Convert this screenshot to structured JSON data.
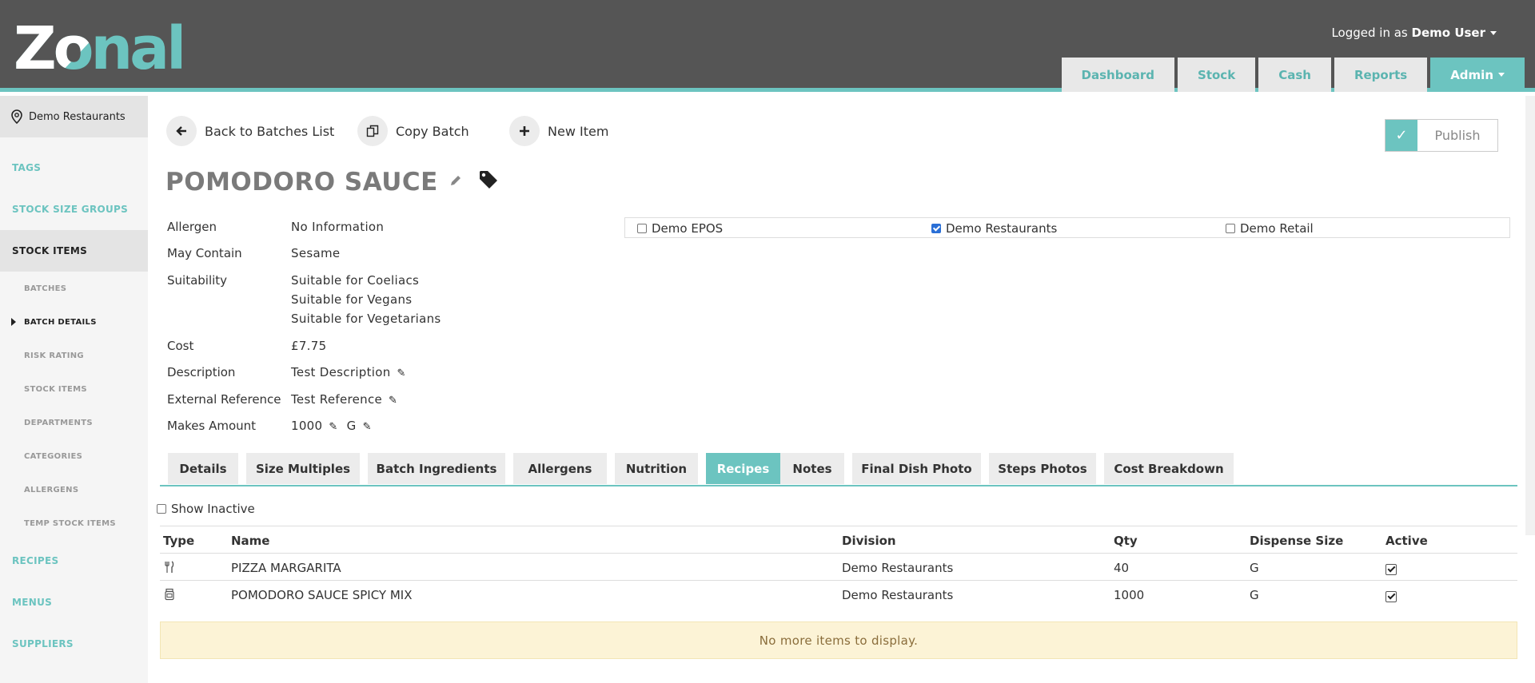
{
  "header": {
    "logo_text": "Zonal",
    "logged_in_prefix": "Logged in as",
    "user_name": "Demo User",
    "nav": [
      "Dashboard",
      "Stock",
      "Cash",
      "Reports",
      "Admin"
    ]
  },
  "sidebar": {
    "site": "Demo Restaurants",
    "items": [
      "TAGS",
      "STOCK SIZE GROUPS",
      "STOCK ITEMS"
    ],
    "sub_items": [
      "BATCHES",
      "BATCH DETAILS",
      "RISK RATING",
      "STOCK ITEMS",
      "DEPARTMENTS",
      "CATEGORIES",
      "ALLERGENS",
      "TEMP STOCK ITEMS"
    ],
    "bottom_items": [
      "RECIPES",
      "MENUS",
      "SUPPLIERS"
    ]
  },
  "actions": {
    "back": "Back to Batches List",
    "copy": "Copy Batch",
    "new": "New Item",
    "publish": "Publish"
  },
  "title": "POMODORO SAUCE",
  "props": {
    "allergen_label": "Allergen",
    "allergen": "No Information",
    "may_contain_label": "May Contain",
    "may_contain": "Sesame",
    "suitability_label": "Suitability",
    "suitability": [
      "Suitable for Coeliacs",
      "Suitable for Vegans",
      "Suitable for Vegetarians"
    ],
    "cost_label": "Cost",
    "cost": "£7.75",
    "description_label": "Description",
    "description": "Test Description",
    "extref_label": "External Reference",
    "extref": "Test Reference",
    "makes_label": "Makes Amount",
    "makes_amount": "1000",
    "makes_unit": "G"
  },
  "divisions": [
    {
      "label": "Demo EPOS",
      "checked": false
    },
    {
      "label": "Demo Restaurants",
      "checked": true
    },
    {
      "label": "Demo Retail",
      "checked": false
    }
  ],
  "tabs": [
    "Details",
    "Size Multiples",
    "Batch Ingredients",
    "Allergens",
    "Nutrition",
    "Recipes",
    "Notes",
    "Final Dish Photo",
    "Steps Photos",
    "Cost Breakdown"
  ],
  "active_tab": "Recipes",
  "show_inactive": "Show Inactive",
  "table": {
    "headers": [
      "Type",
      "Name",
      "Division",
      "Qty",
      "Dispense Size",
      "Active"
    ],
    "rows": [
      {
        "type_icon": "cutlery-icon",
        "name": "PIZZA MARGARITA",
        "division": "Demo Restaurants",
        "qty": "40",
        "dispense": "G",
        "active": true
      },
      {
        "type_icon": "batch-jar-icon",
        "name": "POMODORO SAUCE SPICY MIX",
        "division": "Demo Restaurants",
        "qty": "1000",
        "dispense": "G",
        "active": true
      }
    ]
  },
  "no_more": "No more items to display.",
  "colors": {
    "accent": "#6cc4c0",
    "header_bg": "#555555",
    "notice_bg": "#fcf3d6"
  }
}
